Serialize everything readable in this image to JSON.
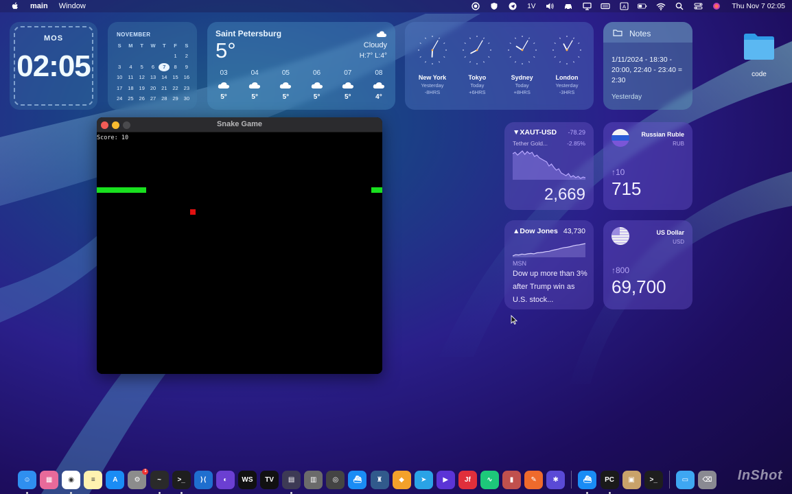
{
  "menubar": {
    "app_name": "main",
    "menus": [
      "Window"
    ],
    "input_source": "1V",
    "datetime": "Thu Nov 7  02:05"
  },
  "widgets": {
    "time": {
      "zone": "MOS",
      "time": "02:05"
    },
    "calendar": {
      "month": "NOVEMBER",
      "weekdays": [
        "S",
        "M",
        "T",
        "W",
        "T",
        "F",
        "S"
      ],
      "days": [
        {
          "d": "",
          "dim": false
        },
        {
          "d": "",
          "dim": false
        },
        {
          "d": "",
          "dim": false
        },
        {
          "d": "",
          "dim": false
        },
        {
          "d": "",
          "dim": false
        },
        {
          "d": "1",
          "dim": false
        },
        {
          "d": "2",
          "dim": false
        },
        {
          "d": "3",
          "dim": false
        },
        {
          "d": "4",
          "dim": false
        },
        {
          "d": "5",
          "dim": false
        },
        {
          "d": "6",
          "dim": false
        },
        {
          "d": "7",
          "today": true
        },
        {
          "d": "8",
          "dim": false
        },
        {
          "d": "9",
          "dim": false
        },
        {
          "d": "10"
        },
        {
          "d": "11"
        },
        {
          "d": "12"
        },
        {
          "d": "13"
        },
        {
          "d": "14"
        },
        {
          "d": "15"
        },
        {
          "d": "16"
        },
        {
          "d": "17"
        },
        {
          "d": "18"
        },
        {
          "d": "19"
        },
        {
          "d": "20"
        },
        {
          "d": "21"
        },
        {
          "d": "22"
        },
        {
          "d": "23"
        },
        {
          "d": "24"
        },
        {
          "d": "25"
        },
        {
          "d": "26"
        },
        {
          "d": "27"
        },
        {
          "d": "28"
        },
        {
          "d": "29"
        },
        {
          "d": "30"
        }
      ]
    },
    "weather": {
      "city": "Saint Petersburg",
      "temp": "5°",
      "condition": "Cloudy",
      "high_low": "H:7° L:4°",
      "hours": [
        {
          "h": "03",
          "t": "5°"
        },
        {
          "h": "04",
          "t": "5°"
        },
        {
          "h": "05",
          "t": "5°"
        },
        {
          "h": "06",
          "t": "5°"
        },
        {
          "h": "07",
          "t": "5°"
        },
        {
          "h": "08",
          "t": "4°"
        }
      ]
    },
    "world_clock": [
      {
        "city": "New York",
        "day": "Yesterday",
        "offset": "-8HRS",
        "hour": 18,
        "minute": 5
      },
      {
        "city": "Tokyo",
        "day": "Today",
        "offset": "+6HRS",
        "hour": 8,
        "minute": 5
      },
      {
        "city": "Sydney",
        "day": "Today",
        "offset": "+8HRS",
        "hour": 10,
        "minute": 5
      },
      {
        "city": "London",
        "day": "Yesterday",
        "offset": "-3HRS",
        "hour": 23,
        "minute": 5
      }
    ],
    "notes": {
      "title": "Notes",
      "body": "1/11/2024 - 18:30 - 20:00, 22:40 - 23:40 = 2:30",
      "footer": "Yesterday"
    },
    "stock": {
      "symbol": "▼XAUT-USD",
      "change": "-78.29",
      "name": "Tether Gold...",
      "percent": "-2.85%",
      "price": "2,669",
      "spark": [
        70,
        72,
        68,
        71,
        74,
        69,
        73,
        70,
        72,
        66,
        68,
        64,
        62,
        60,
        58,
        52,
        55,
        50,
        46,
        48,
        42,
        40,
        38,
        41,
        36,
        38,
        35,
        37,
        34,
        36,
        35
      ]
    },
    "dow": {
      "symbol": "▲Dow Jones",
      "value": "43,730",
      "source": "MSN",
      "headline": "Dow up more than 3% after Trump win as U.S. stock...",
      "spark": [
        30,
        34,
        33,
        36,
        35,
        37,
        38,
        37,
        40,
        41,
        42,
        44,
        45,
        48,
        50,
        52,
        55,
        57,
        58,
        60,
        63,
        65,
        66,
        68,
        70
      ]
    },
    "rub": {
      "name": "Russian Ruble",
      "code": "RUB",
      "delta": "↑10",
      "amount": "715"
    },
    "usd": {
      "name": "US Dollar",
      "code": "USD",
      "delta": "↑800",
      "amount": "69,700"
    }
  },
  "desktop": {
    "folder_label": "code"
  },
  "game_window": {
    "title": "Snake Game",
    "score_text": "Score: 10"
  },
  "dock": {
    "items": [
      {
        "name": "finder",
        "bg": "#2f8ff0",
        "glyph": "☺",
        "running": true
      },
      {
        "name": "launchpad",
        "bg": "#e86a9a",
        "glyph": "▦"
      },
      {
        "name": "chrome",
        "bg": "#ffffff",
        "glyph": "◉",
        "running": true
      },
      {
        "name": "notes",
        "bg": "#fff2b0",
        "glyph": "≡"
      },
      {
        "name": "app-store",
        "bg": "#1a8cf5",
        "glyph": "A"
      },
      {
        "name": "system-settings",
        "bg": "#8c8c8c",
        "glyph": "⚙",
        "badge": "1"
      },
      {
        "name": "activity-monitor",
        "bg": "#2a2a2a",
        "glyph": "~",
        "running": true
      },
      {
        "name": "terminal",
        "bg": "#1e1e1e",
        "glyph": ">_",
        "running": true
      },
      {
        "name": "vscode",
        "bg": "#1f6fcf",
        "glyph": "⟩⟨"
      },
      {
        "name": "github-desktop",
        "bg": "#6b3fd2",
        "glyph": "◐"
      },
      {
        "name": "webstorm",
        "bg": "#111111",
        "glyph": "WS"
      },
      {
        "name": "tradingview",
        "bg": "#111111",
        "glyph": "TV"
      },
      {
        "name": "clapper",
        "bg": "#3d3a55",
        "glyph": "▤",
        "running": true
      },
      {
        "name": "calculator",
        "bg": "#6b6b6b",
        "glyph": "▥"
      },
      {
        "name": "screenshot",
        "bg": "#444",
        "glyph": "◎"
      },
      {
        "name": "docker",
        "bg": "#1a8cf5",
        "glyph": "⛴"
      },
      {
        "name": "pgadmin",
        "bg": "#315a8c",
        "glyph": "♜"
      },
      {
        "name": "sublime-merge",
        "bg": "#f3a12b",
        "glyph": "◆"
      },
      {
        "name": "telegram",
        "bg": "#2aa3e6",
        "glyph": "➤"
      },
      {
        "name": "infuse",
        "bg": "#5b34d6",
        "glyph": "▶"
      },
      {
        "name": "jetbrains",
        "bg": "#e02f3b",
        "glyph": "Jf"
      },
      {
        "name": "activity",
        "bg": "#1dc87a",
        "glyph": "∿"
      },
      {
        "name": "archive",
        "bg": "#c0504d",
        "glyph": "▮"
      },
      {
        "name": "pencil",
        "bg": "#ee6a2c",
        "glyph": "✎"
      },
      {
        "name": "colorslurp",
        "bg": "#5a4ad6",
        "glyph": "✱"
      },
      {
        "name": "docker-2",
        "bg": "#1a8cf5",
        "glyph": "⛴",
        "running": true
      },
      {
        "name": "pycharm",
        "bg": "#1a1a1a",
        "glyph": "PC",
        "running": true
      },
      {
        "name": "package",
        "bg": "#c9a26a",
        "glyph": "▣"
      },
      {
        "name": "terminal-2",
        "bg": "#1e1e1e",
        "glyph": ">_"
      },
      {
        "name": "downloads",
        "bg": "#3ea7f2",
        "glyph": "▭"
      },
      {
        "name": "trash",
        "bg": "#8a8a92",
        "glyph": "⌫"
      }
    ]
  },
  "watermark": "InShot",
  "colors": {
    "snake": "#19e01f",
    "food": "#e01010"
  }
}
